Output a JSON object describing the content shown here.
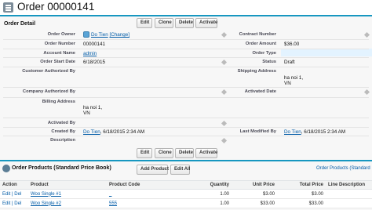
{
  "header": {
    "title": "Order 00000141"
  },
  "detail": {
    "section_title": "Order Detail",
    "buttons": {
      "edit": "Edit",
      "clone": "Clone",
      "delete": "Delete",
      "activate": "Activate"
    },
    "labels": {
      "order_owner": "Order Owner",
      "order_number": "Order Number",
      "account_name": "Account Name",
      "order_start_date": "Order Start Date",
      "customer_authorized_by": "Customer Authorized By",
      "company_authorized_by": "Company Authorized By",
      "billing_address": "Billing Address",
      "activated_by": "Activated By",
      "created_by": "Created By",
      "description": "Description",
      "contract_number": "Contract Number",
      "order_amount": "Order Amount",
      "order_type": "Order Type",
      "status": "Status",
      "shipping_address": "Shipping Address",
      "activated_date": "Activated Date",
      "last_modified_by": "Last Modified By"
    },
    "values": {
      "order_owner_name": "Do Tien",
      "change_link": "[Change]",
      "order_number": "00000141",
      "account_name": "admin",
      "order_start_date": "6/18/2015",
      "billing_line1": "ha noi 1,",
      "billing_line2": "VN",
      "created_by_name": "Do Tien",
      "created_by_date": ", 6/18/2015 2:34 AM",
      "order_amount": "$36.00",
      "status": "Draft",
      "shipping_line1": "ha noi 1,",
      "shipping_line2": "VN",
      "last_modified_name": "Do Tien",
      "last_modified_date": ", 6/18/2015 2:34 AM"
    }
  },
  "related": {
    "title": "Order Products (Standard Price Book)",
    "add_product": "Add Product",
    "edit_all": "Edit All",
    "help_link": "Order Products (Standard",
    "columns": [
      "Action",
      "Product",
      "Product Code",
      "Quantity",
      "Unit Price",
      "Total Price",
      "Line Description"
    ],
    "row_edit": "Edit",
    "row_sep": "|",
    "row_del": "Del",
    "rows": [
      {
        "product": "Woo Single #1",
        "code": "_",
        "quantity": "1.00",
        "unit_price": "$3.00",
        "total_price": "$3.00",
        "line_description": ""
      },
      {
        "product": "Woo Single #2",
        "code": "555",
        "quantity": "1.00",
        "unit_price": "$33.00",
        "total_price": "$33.00",
        "line_description": ""
      }
    ]
  }
}
